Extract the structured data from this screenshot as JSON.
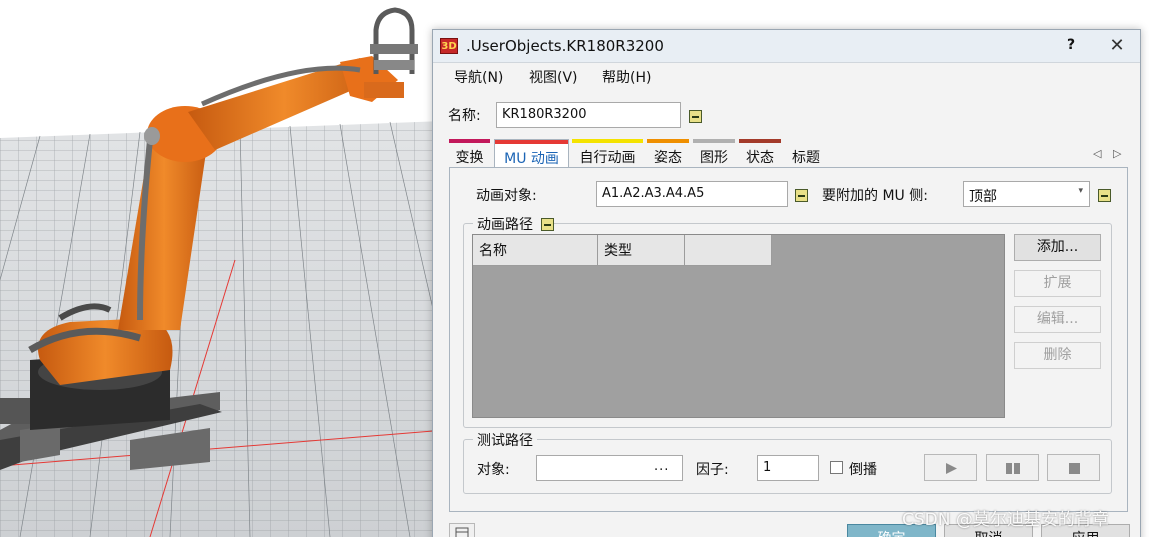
{
  "window": {
    "icon_text": "3D",
    "title": ".UserObjects.KR180R3200",
    "help_label": "?",
    "close_label": "✕"
  },
  "menu": [
    "导航(N)",
    "视图(V)",
    "帮助(H)"
  ],
  "name_field": {
    "label": "名称:",
    "value": "KR180R3200"
  },
  "tabs": [
    {
      "label": "变换",
      "color": "#c2185b",
      "active": false
    },
    {
      "label": "MU 动画",
      "color": "#e53935",
      "active": true
    },
    {
      "label": "自行动画",
      "color": "#f4e300",
      "active": false
    },
    {
      "label": "姿态",
      "color": "#ef8f00",
      "active": false
    },
    {
      "label": "图形",
      "color": "#b0b0b0",
      "active": false
    },
    {
      "label": "状态",
      "color": "#a33a2a",
      "active": false
    },
    {
      "label": "标题",
      "color": null,
      "active": false
    }
  ],
  "tab_scroll": {
    "left": "◁",
    "right": "▷"
  },
  "animation": {
    "object_label": "动画对象:",
    "object_value": "A1.A2.A3.A4.A5",
    "side_label": "要附加的 MU 侧:",
    "side_value": "顶部",
    "side_arrow": "▾"
  },
  "path_group": {
    "title": "动画路径",
    "columns": [
      "名称",
      "类型",
      ""
    ],
    "rows": [],
    "buttons": [
      {
        "label": "添加...",
        "enabled": true
      },
      {
        "label": "扩展",
        "enabled": false
      },
      {
        "label": "编辑...",
        "enabled": false
      },
      {
        "label": "删除",
        "enabled": false
      }
    ]
  },
  "test_group": {
    "title": "测试路径",
    "object_label": "对象:",
    "object_value": "",
    "browse_label": "...",
    "factor_label": "因子:",
    "factor_value": "1",
    "reverse_label": "倒播",
    "reverse_checked": false,
    "controls": [
      "play-icon",
      "pause-icon",
      "stop-icon"
    ]
  },
  "bottom_buttons": [
    "确定",
    "取消",
    "应用"
  ],
  "watermark": "CSDN @莫尔迪基安的背章",
  "colors": {
    "accent": "#1b64b5",
    "robot_orange": "#e8701a",
    "ok_button": "#7fb6c9"
  }
}
